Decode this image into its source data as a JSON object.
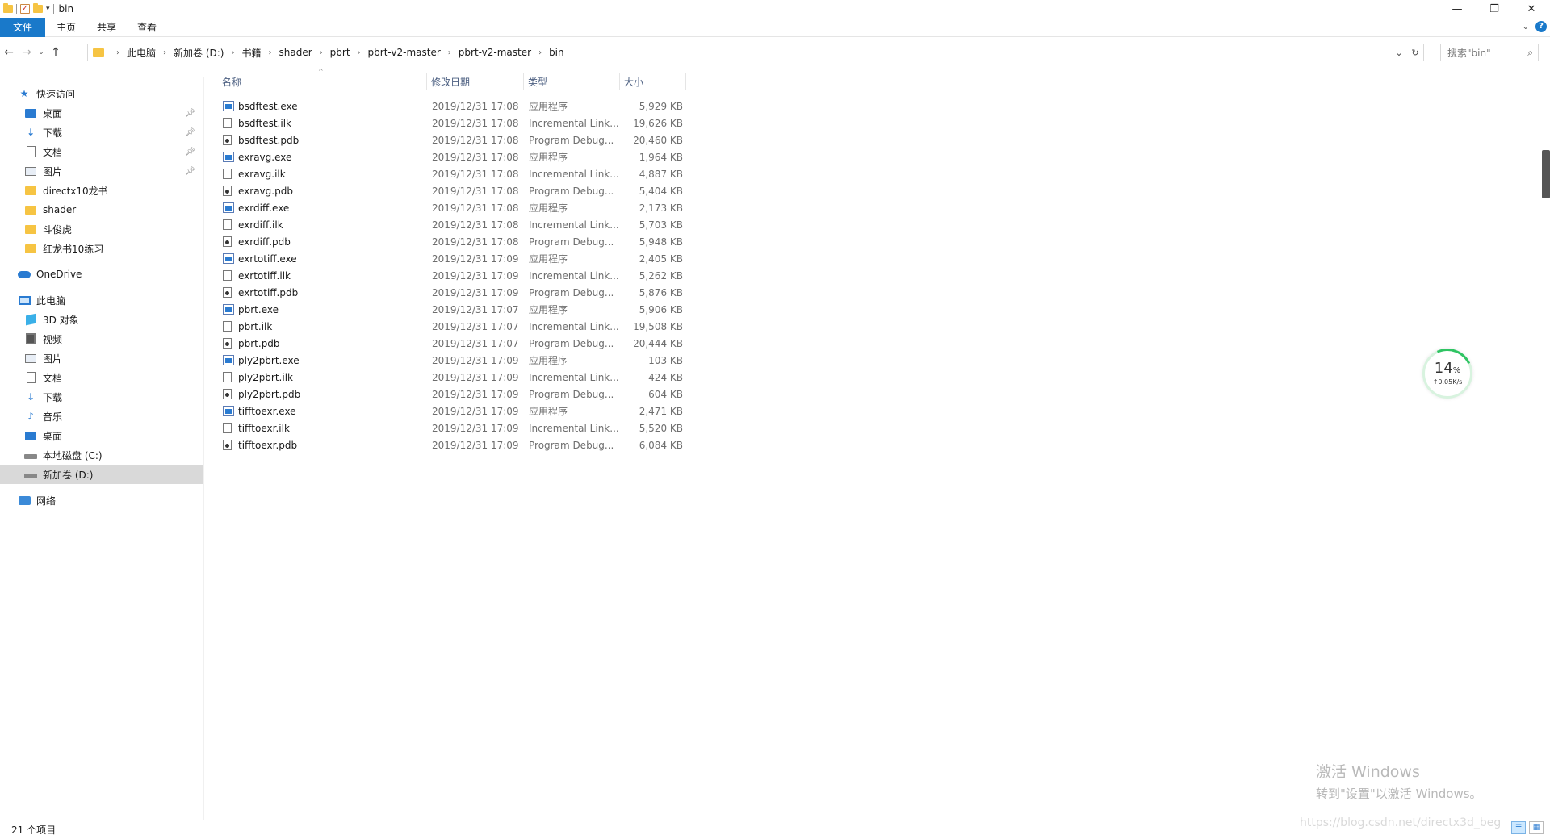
{
  "window": {
    "title": "bin"
  },
  "window_controls": {
    "minimize": "—",
    "maximize": "❐",
    "close": "✕"
  },
  "ribbon": {
    "tabs": [
      "文件",
      "主页",
      "共享",
      "查看"
    ]
  },
  "address": {
    "crumbs": [
      "此电脑",
      "新加卷 (D:)",
      "书籍",
      "shader",
      "pbrt",
      "pbrt-v2-master",
      "pbrt-v2-master",
      "bin"
    ]
  },
  "search": {
    "placeholder": "搜索\"bin\""
  },
  "sidebar": {
    "quick_access": "快速访问",
    "quick_items": [
      {
        "label": "桌面",
        "icon": "desktop-icon",
        "pinned": true
      },
      {
        "label": "下载",
        "icon": "download-icon",
        "pinned": true
      },
      {
        "label": "文档",
        "icon": "document-icon",
        "pinned": true
      },
      {
        "label": "图片",
        "icon": "picture-icon",
        "pinned": true
      },
      {
        "label": "directx10龙书",
        "icon": "folder-icon",
        "pinned": false
      },
      {
        "label": "shader",
        "icon": "folder-icon",
        "pinned": false
      },
      {
        "label": "斗俊虎",
        "icon": "folder-icon",
        "pinned": false
      },
      {
        "label": "红龙书10练习",
        "icon": "folder-icon",
        "pinned": false
      }
    ],
    "onedrive": "OneDrive",
    "this_pc": "此电脑",
    "pc_items": [
      {
        "label": "3D 对象",
        "icon": "3d-objects-icon"
      },
      {
        "label": "视频",
        "icon": "video-icon"
      },
      {
        "label": "图片",
        "icon": "picture-icon"
      },
      {
        "label": "文档",
        "icon": "document-icon"
      },
      {
        "label": "下载",
        "icon": "download-icon"
      },
      {
        "label": "音乐",
        "icon": "music-icon"
      },
      {
        "label": "桌面",
        "icon": "desktop-icon"
      },
      {
        "label": "本地磁盘 (C:)",
        "icon": "drive-icon"
      },
      {
        "label": "新加卷 (D:)",
        "icon": "drive-icon",
        "selected": true
      }
    ],
    "network": "网络"
  },
  "columns": {
    "name": "名称",
    "date": "修改日期",
    "type": "类型",
    "size": "大小"
  },
  "files": [
    {
      "name": "bsdftest.exe",
      "date": "2019/12/31 17:08",
      "type": "应用程序",
      "size": "5,929 KB",
      "kind": "exe"
    },
    {
      "name": "bsdftest.ilk",
      "date": "2019/12/31 17:08",
      "type": "Incremental Link...",
      "size": "19,626 KB",
      "kind": "ilk"
    },
    {
      "name": "bsdftest.pdb",
      "date": "2019/12/31 17:08",
      "type": "Program Debug...",
      "size": "20,460 KB",
      "kind": "pdb"
    },
    {
      "name": "exravg.exe",
      "date": "2019/12/31 17:08",
      "type": "应用程序",
      "size": "1,964 KB",
      "kind": "exe"
    },
    {
      "name": "exravg.ilk",
      "date": "2019/12/31 17:08",
      "type": "Incremental Link...",
      "size": "4,887 KB",
      "kind": "ilk"
    },
    {
      "name": "exravg.pdb",
      "date": "2019/12/31 17:08",
      "type": "Program Debug...",
      "size": "5,404 KB",
      "kind": "pdb"
    },
    {
      "name": "exrdiff.exe",
      "date": "2019/12/31 17:08",
      "type": "应用程序",
      "size": "2,173 KB",
      "kind": "exe"
    },
    {
      "name": "exrdiff.ilk",
      "date": "2019/12/31 17:08",
      "type": "Incremental Link...",
      "size": "5,703 KB",
      "kind": "ilk"
    },
    {
      "name": "exrdiff.pdb",
      "date": "2019/12/31 17:08",
      "type": "Program Debug...",
      "size": "5,948 KB",
      "kind": "pdb"
    },
    {
      "name": "exrtotiff.exe",
      "date": "2019/12/31 17:09",
      "type": "应用程序",
      "size": "2,405 KB",
      "kind": "exe"
    },
    {
      "name": "exrtotiff.ilk",
      "date": "2019/12/31 17:09",
      "type": "Incremental Link...",
      "size": "5,262 KB",
      "kind": "ilk"
    },
    {
      "name": "exrtotiff.pdb",
      "date": "2019/12/31 17:09",
      "type": "Program Debug...",
      "size": "5,876 KB",
      "kind": "pdb"
    },
    {
      "name": "pbrt.exe",
      "date": "2019/12/31 17:07",
      "type": "应用程序",
      "size": "5,906 KB",
      "kind": "exe"
    },
    {
      "name": "pbrt.ilk",
      "date": "2019/12/31 17:07",
      "type": "Incremental Link...",
      "size": "19,508 KB",
      "kind": "ilk"
    },
    {
      "name": "pbrt.pdb",
      "date": "2019/12/31 17:07",
      "type": "Program Debug...",
      "size": "20,444 KB",
      "kind": "pdb"
    },
    {
      "name": "ply2pbrt.exe",
      "date": "2019/12/31 17:09",
      "type": "应用程序",
      "size": "103 KB",
      "kind": "exe"
    },
    {
      "name": "ply2pbrt.ilk",
      "date": "2019/12/31 17:09",
      "type": "Incremental Link...",
      "size": "424 KB",
      "kind": "ilk"
    },
    {
      "name": "ply2pbrt.pdb",
      "date": "2019/12/31 17:09",
      "type": "Program Debug...",
      "size": "604 KB",
      "kind": "pdb"
    },
    {
      "name": "tifftoexr.exe",
      "date": "2019/12/31 17:09",
      "type": "应用程序",
      "size": "2,471 KB",
      "kind": "exe"
    },
    {
      "name": "tifftoexr.ilk",
      "date": "2019/12/31 17:09",
      "type": "Incremental Link...",
      "size": "5,520 KB",
      "kind": "ilk"
    },
    {
      "name": "tifftoexr.pdb",
      "date": "2019/12/31 17:09",
      "type": "Program Debug...",
      "size": "6,084 KB",
      "kind": "pdb"
    }
  ],
  "status": {
    "count": "21 个项目"
  },
  "net_widget": {
    "percent": "14",
    "unit": "%",
    "speed": "↑0.05K/s"
  },
  "activation": {
    "line1": "激活 Windows",
    "line2": "转到\"设置\"以激活 Windows。"
  },
  "watermark": "https://blog.csdn.net/directx3d_beg"
}
